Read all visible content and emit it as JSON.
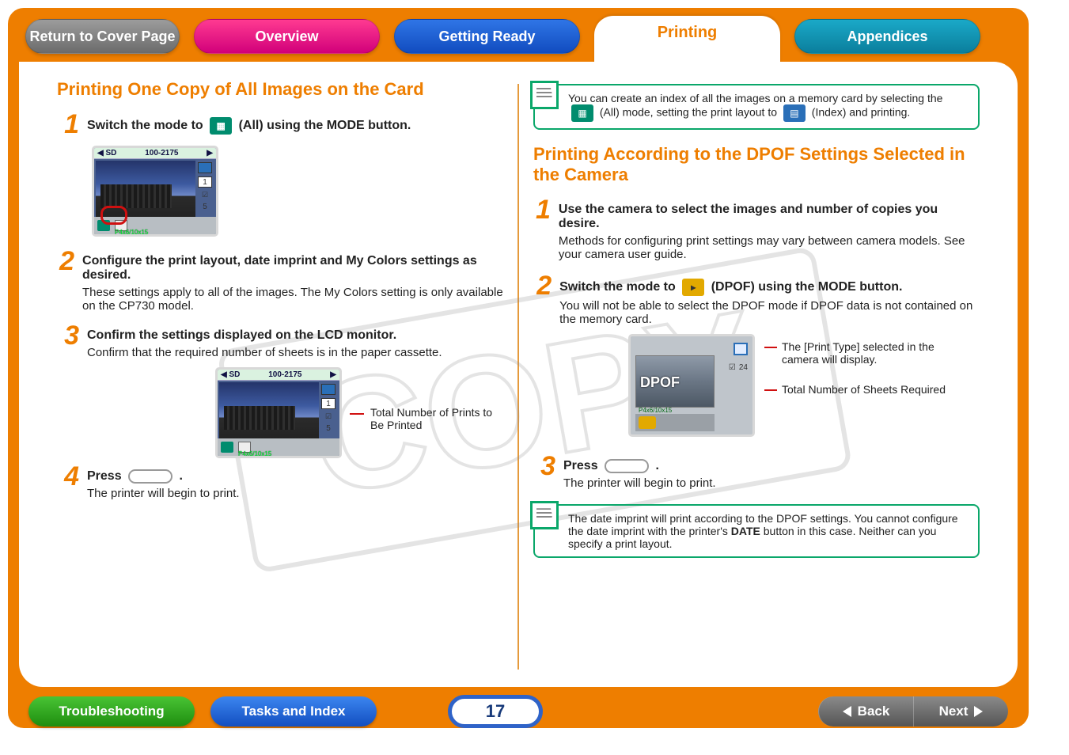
{
  "tabs": {
    "cover": "Return to Cover Page",
    "overview": "Overview",
    "ready": "Getting Ready",
    "printing": "Printing",
    "appendix": "Appendices"
  },
  "left": {
    "title": "Printing One Copy of All Images on the Card",
    "step1a": "Switch the mode to ",
    "step1b": " (All) using the ",
    "step1c": "MODE",
    "step1d": " button.",
    "lcd1_top": "100-2175",
    "lcd1_num1": "1",
    "lcd1_num5": "5",
    "lcd1_foot": "P4x6/10x15",
    "step2a": "Configure the print layout, date imprint and My Colors settings as desired.",
    "step2b": "These settings apply to all of the images. The My Colors setting is only available on the CP730 model.",
    "step3a": "Confirm the settings displayed on the LCD monitor.",
    "step3b": "Confirm that the required number of sheets is in the paper cassette.",
    "annot1": "Total Number of Prints to Be Printed",
    "step4a": "Press ",
    "step4b": ".",
    "step4c": "The printer will begin to print."
  },
  "right": {
    "tip1a": "You can create an index of all the images on a memory card by selecting the ",
    "tip1b": " (All) mode, setting the print layout to ",
    "tip1c": " (Index) and printing.",
    "title": "Printing According to the DPOF Settings Selected in the Camera",
    "step1a": "Use the camera to select the images and number of copies you desire.",
    "step1b": "Methods for configuring print settings may vary between camera models. See your camera user guide.",
    "step2a": "Switch the mode to ",
    "step2b": " (DPOF) using the ",
    "step2c": "MODE",
    "step2d": " button.",
    "step2e": "You will not be able to select the DPOF mode if DPOF data is not contained on the memory card.",
    "lcd2_dpof": "DPOF",
    "lcd2_24": "24",
    "lcd2_foot": "P4x6/10x15",
    "annot_a": "The [Print Type] selected in the camera will display.",
    "annot_b": "Total Number of Sheets Required",
    "step3a": "Press ",
    "step3b": ".",
    "step3c": "The printer will begin to print.",
    "tip2": "The date imprint will print according to the DPOF settings. You cannot configure the date imprint with the printer's ",
    "tip2b": "DATE",
    "tip2c": " button in this case. Neither can you specify a print layout."
  },
  "bottom": {
    "trouble": "Troubleshooting",
    "tasks": "Tasks and Index",
    "page": "17",
    "back": "Back",
    "next": "Next"
  },
  "watermark": "COPY"
}
